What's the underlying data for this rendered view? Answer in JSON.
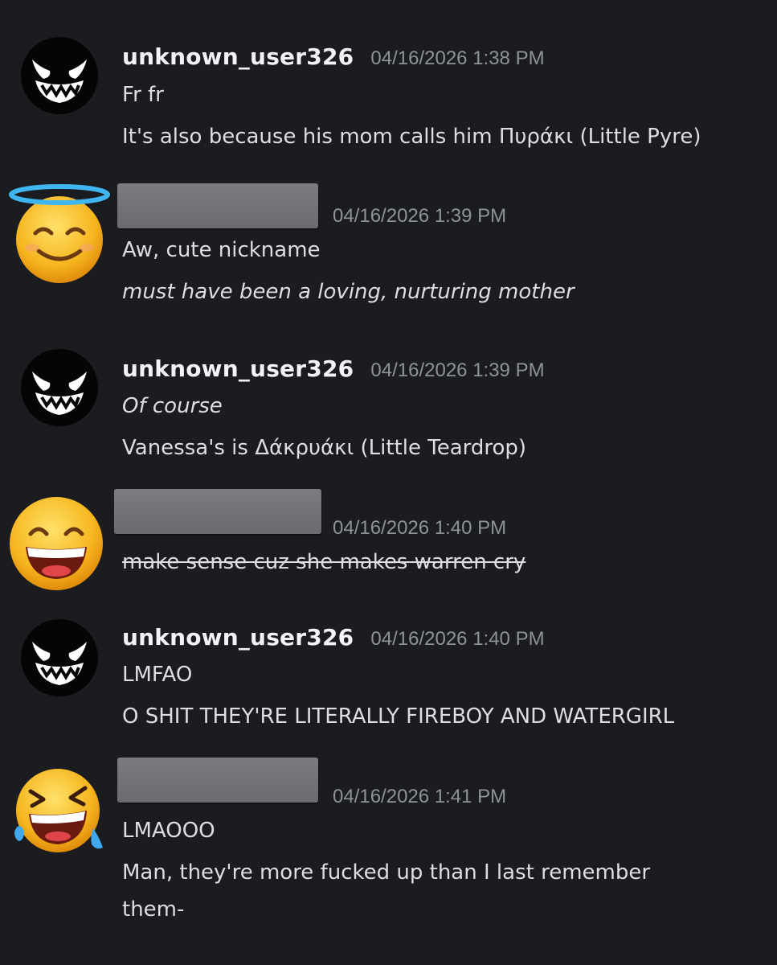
{
  "messages": [
    {
      "author": "unknown_user326",
      "timestamp": "04/16/2026 1:38 PM",
      "avatar_icon": "evil-grin-face-icon",
      "lines": [
        "Fr fr",
        "It's also because his mom calls him Πυράκι (Little Pyre)"
      ]
    },
    {
      "author_redacted": true,
      "timestamp": "04/16/2026 1:39 PM",
      "avatar_icon": "smiling-face-with-halo-icon",
      "lines": [
        "Aw, cute nickname",
        "must have been a loving, nurturing mother"
      ]
    },
    {
      "author": "unknown_user326",
      "timestamp": "04/16/2026 1:39 PM",
      "avatar_icon": "evil-grin-face-icon",
      "lines": [
        "Of course",
        "Vanessa's is Δάκρυάκι (Little Teardrop)"
      ]
    },
    {
      "author_redacted": true,
      "timestamp": "04/16/2026 1:40 PM",
      "avatar_icon": "grinning-squinting-face-icon",
      "lines": [
        "make sense cuz she makes warren cry"
      ]
    },
    {
      "author": "unknown_user326",
      "timestamp": "04/16/2026 1:40 PM",
      "avatar_icon": "evil-grin-face-icon",
      "lines": [
        "LMFAO",
        "O SHIT THEY'RE LITERALLY FIREBOY AND WATERGIRL"
      ]
    },
    {
      "author_redacted": true,
      "timestamp": "04/16/2026 1:41 PM",
      "avatar_icon": "rolling-on-floor-laughing-icon",
      "lines": [
        "LMAOOO",
        "Man, they're more fucked up than I last remember",
        "them-"
      ]
    }
  ],
  "colors": {
    "background": "#1b1c20",
    "username": "#f2f3f5",
    "timestamp": "#8f929a",
    "text": "#dddee3",
    "redaction": "#727276"
  }
}
